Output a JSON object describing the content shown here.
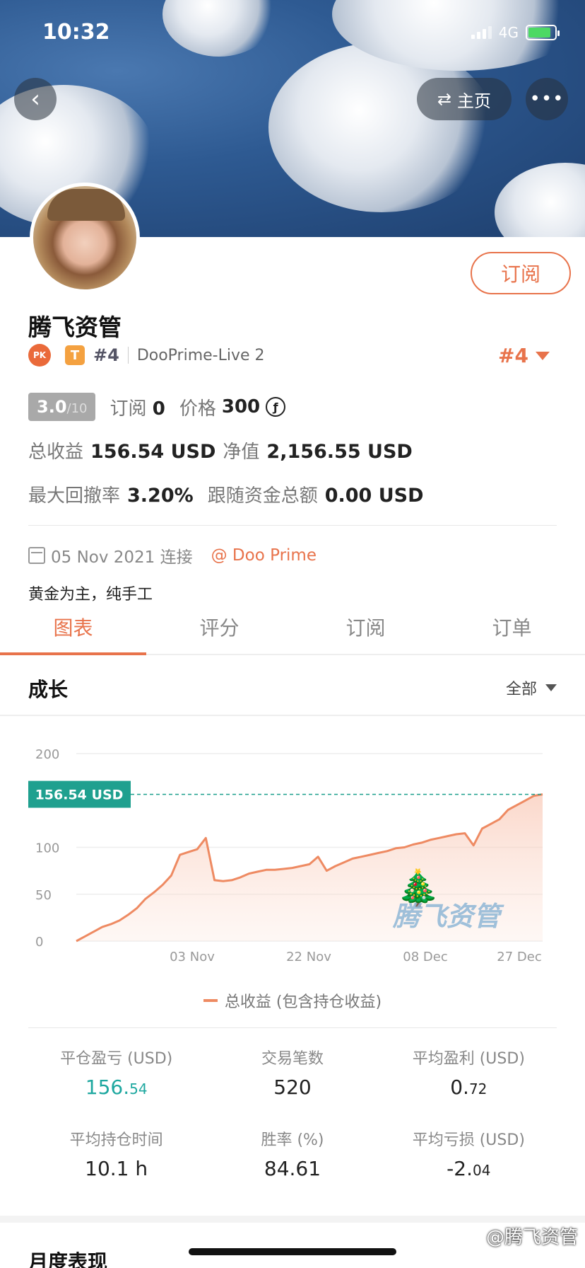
{
  "status": {
    "time": "10:32",
    "network": "4G"
  },
  "nav": {
    "home_label": "主页",
    "more_label": "•••"
  },
  "profile": {
    "name": "腾飞资管",
    "pk_badge": "PK",
    "tier_badge": "T",
    "rank_small": "#4",
    "server": "DooPrime-Live 2",
    "rank_big": "#4",
    "subscribe_label": "订阅",
    "score": "3.0",
    "score_max": "/10",
    "subscribe_text": "订阅",
    "subscribers": "0",
    "price_text": "价格",
    "price": "300",
    "total_profit_label": "总收益",
    "total_profit": "156.54 USD",
    "equity_label": "净值",
    "equity": "2,156.55 USD",
    "max_drawdown_label": "最大回撤率",
    "max_drawdown": "3.20%",
    "copy_funds_label": "跟随资金总额",
    "copy_funds": "0.00 USD",
    "connected": "05 Nov 2021 连接",
    "broker": "@ Doo Prime",
    "bio": "黄金为主，纯手工"
  },
  "tabs": [
    {
      "label": "图表",
      "active": true
    },
    {
      "label": "评分",
      "active": false
    },
    {
      "label": "订阅",
      "active": false
    },
    {
      "label": "订单",
      "active": false
    }
  ],
  "growth": {
    "title": "成长",
    "range": "全部"
  },
  "chart_data": {
    "type": "area",
    "x_ticks": [
      "03 Nov",
      "22 Nov",
      "08 Dec",
      "27 Dec"
    ],
    "y_ticks": [
      "0",
      "50",
      "100",
      "200"
    ],
    "ylim": [
      0,
      200
    ],
    "current_label": "156.54 USD",
    "current_value": 156.54,
    "legend": "总收益 (包含持仓收益)",
    "watermark": "腾飞资管",
    "series": [
      {
        "name": "总收益 (包含持仓收益)",
        "values": [
          0,
          5,
          10,
          15,
          18,
          22,
          28,
          35,
          45,
          52,
          60,
          70,
          92,
          95,
          98,
          110,
          65,
          64,
          65,
          68,
          72,
          74,
          76,
          76,
          77,
          78,
          80,
          82,
          90,
          75,
          80,
          84,
          88,
          90,
          92,
          94,
          96,
          99,
          100,
          103,
          105,
          108,
          110,
          112,
          114,
          115,
          102,
          120,
          125,
          130,
          140,
          145,
          150,
          155,
          156.54
        ]
      }
    ],
    "color": "#ee8a62",
    "label_color": "#1fa08f"
  },
  "metrics": [
    {
      "label": "平仓盈亏 (USD)",
      "main": "156.",
      "frac": "54",
      "teal": true
    },
    {
      "label": "交易笔数",
      "main": "520",
      "frac": "",
      "teal": false
    },
    {
      "label": "平均盈利 (USD)",
      "main": "0.",
      "frac": "72",
      "teal": false
    },
    {
      "label": "平均持仓时间",
      "main": "10.1 h",
      "frac": "",
      "teal": false
    },
    {
      "label": "胜率 (%)",
      "main": "84.61",
      "frac": "",
      "teal": false
    },
    {
      "label": "平均亏损 (USD)",
      "main": "-2.",
      "frac": "04",
      "teal": false
    }
  ],
  "monthly": {
    "title": "月度表现"
  },
  "watermark_bottom": "@腾飞资管"
}
